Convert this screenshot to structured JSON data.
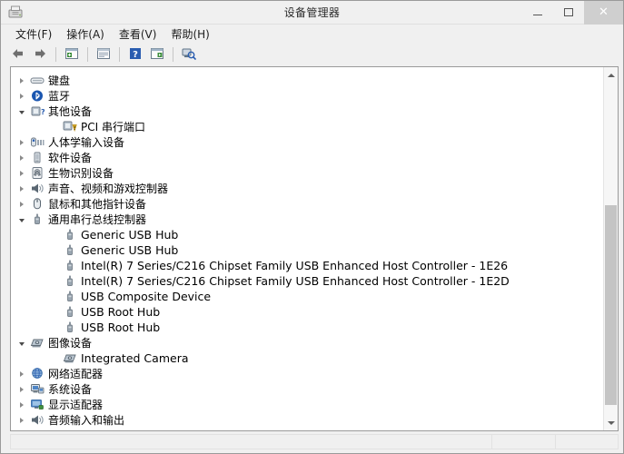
{
  "window": {
    "title": "设备管理器",
    "app_icon": "device-manager-icon",
    "minimize_label": "最小化",
    "maximize_label": "最大化",
    "close_label": "关闭"
  },
  "menubar": {
    "items": [
      {
        "label": "文件(F)",
        "name": "menu-file"
      },
      {
        "label": "操作(A)",
        "name": "menu-action"
      },
      {
        "label": "查看(V)",
        "name": "menu-view"
      },
      {
        "label": "帮助(H)",
        "name": "menu-help"
      }
    ]
  },
  "toolbar": {
    "buttons": [
      {
        "icon": "back-arrow-icon",
        "tip": "后退"
      },
      {
        "icon": "forward-arrow-icon",
        "tip": "前进"
      },
      {
        "icon": "properties-icon",
        "tip": "属性"
      },
      {
        "icon": "update-driver-icon",
        "tip": "更新驱动程序"
      },
      {
        "icon": "help-icon",
        "tip": "帮助"
      },
      {
        "icon": "show-hidden-icon",
        "tip": "显示隐藏的设备"
      },
      {
        "icon": "scan-hardware-icon",
        "tip": "扫描检测硬件改动"
      }
    ]
  },
  "tree": {
    "nodes": [
      {
        "label": "键盘",
        "level": 1,
        "state": "collapsed",
        "icon": "keyboard-icon",
        "script": "cjk"
      },
      {
        "label": "蓝牙",
        "level": 1,
        "state": "collapsed",
        "icon": "bluetooth-icon",
        "script": "cjk"
      },
      {
        "label": "其他设备",
        "level": 1,
        "state": "expanded",
        "icon": "other-devices-icon",
        "script": "cjk"
      },
      {
        "label": "PCI 串行端口",
        "level": 2,
        "state": "leaf",
        "icon": "warning-device-icon",
        "script": "cjk"
      },
      {
        "label": "人体学输入设备",
        "level": 1,
        "state": "collapsed",
        "icon": "hid-icon",
        "script": "cjk"
      },
      {
        "label": "软件设备",
        "level": 1,
        "state": "collapsed",
        "icon": "software-device-icon",
        "script": "cjk"
      },
      {
        "label": "生物识别设备",
        "level": 1,
        "state": "collapsed",
        "icon": "biometric-icon",
        "script": "cjk"
      },
      {
        "label": "声音、视频和游戏控制器",
        "level": 1,
        "state": "collapsed",
        "icon": "sound-icon",
        "script": "cjk"
      },
      {
        "label": "鼠标和其他指针设备",
        "level": 1,
        "state": "collapsed",
        "icon": "mouse-icon",
        "script": "cjk"
      },
      {
        "label": "通用串行总线控制器",
        "level": 1,
        "state": "expanded",
        "icon": "usb-icon",
        "script": "cjk"
      },
      {
        "label": "Generic USB Hub",
        "level": 2,
        "state": "leaf",
        "icon": "usb-icon",
        "script": "latin"
      },
      {
        "label": "Generic USB Hub",
        "level": 2,
        "state": "leaf",
        "icon": "usb-icon",
        "script": "latin"
      },
      {
        "label": "Intel(R) 7 Series/C216 Chipset Family USB Enhanced Host Controller - 1E26",
        "level": 2,
        "state": "leaf",
        "icon": "usb-icon",
        "script": "latin"
      },
      {
        "label": "Intel(R) 7 Series/C216 Chipset Family USB Enhanced Host Controller - 1E2D",
        "level": 2,
        "state": "leaf",
        "icon": "usb-icon",
        "script": "latin"
      },
      {
        "label": "USB Composite Device",
        "level": 2,
        "state": "leaf",
        "icon": "usb-icon",
        "script": "latin"
      },
      {
        "label": "USB Root Hub",
        "level": 2,
        "state": "leaf",
        "icon": "usb-icon",
        "script": "latin"
      },
      {
        "label": "USB Root Hub",
        "level": 2,
        "state": "leaf",
        "icon": "usb-icon",
        "script": "latin"
      },
      {
        "label": "图像设备",
        "level": 1,
        "state": "expanded",
        "icon": "imaging-icon",
        "script": "cjk"
      },
      {
        "label": "Integrated Camera",
        "level": 2,
        "state": "leaf",
        "icon": "imaging-icon",
        "script": "latin"
      },
      {
        "label": "网络适配器",
        "level": 1,
        "state": "collapsed",
        "icon": "network-icon",
        "script": "cjk"
      },
      {
        "label": "系统设备",
        "level": 1,
        "state": "collapsed",
        "icon": "system-device-icon",
        "script": "cjk"
      },
      {
        "label": "显示适配器",
        "level": 1,
        "state": "collapsed",
        "icon": "display-icon",
        "script": "cjk"
      },
      {
        "label": "音频输入和输出",
        "level": 1,
        "state": "collapsed",
        "icon": "audio-io-icon",
        "script": "cjk"
      }
    ]
  },
  "scrollbar": {
    "up_arrow": "scroll-up-arrow-icon",
    "down_arrow": "scroll-down-arrow-icon",
    "thumb_top_pct": 37,
    "thumb_height_pct": 60
  },
  "statusbar": {
    "main": "",
    "mid": "",
    "right": ""
  },
  "colors": {
    "window_bg": "#f0f0f0",
    "panel_bg": "#ffffff",
    "border": "#9a9a9a",
    "accent_blue": "#2a5db0",
    "warning_yellow": "#f2c12e",
    "close_hover": "#cfcfcf",
    "scroll_thumb": "#c4c4c4"
  }
}
